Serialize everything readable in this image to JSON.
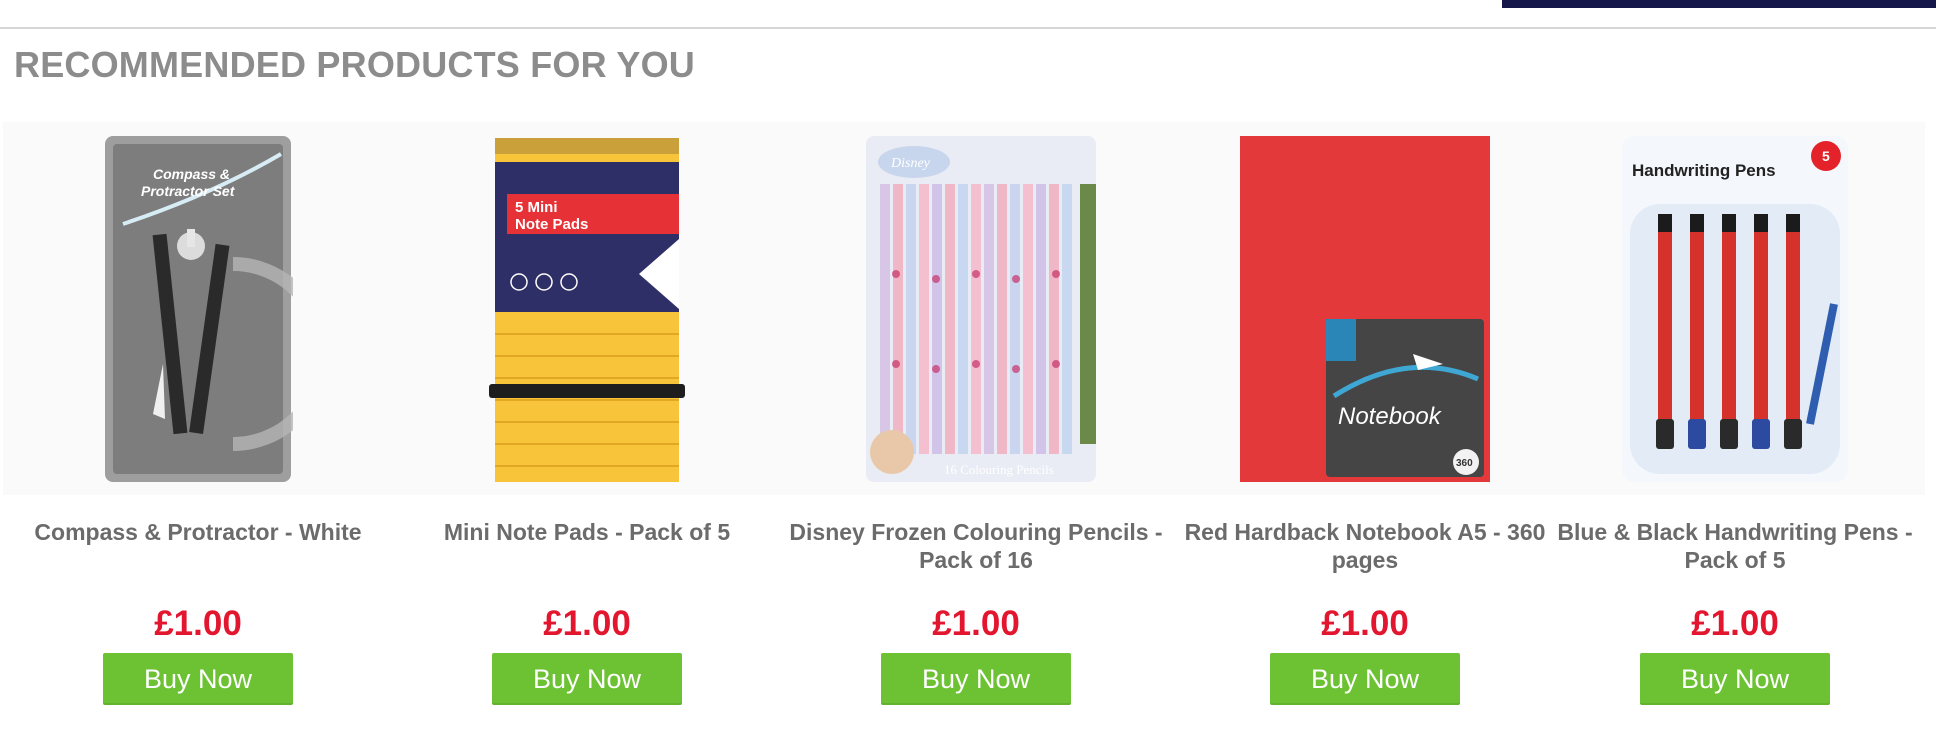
{
  "section": {
    "title": "RECOMMENDED PRODUCTS FOR YOU"
  },
  "products": [
    {
      "name": "Compass & Protractor - White",
      "price": "£1.00",
      "buy_label": "Buy Now",
      "package_text": [
        "Compass &",
        "Protractor Set"
      ]
    },
    {
      "name": "Mini Note Pads - Pack of 5",
      "price": "£1.00",
      "buy_label": "Buy Now",
      "package_text": [
        "5 Mini",
        "Note Pads"
      ]
    },
    {
      "name": "Disney Frozen Colouring Pencils - Pack of 16",
      "price": "£1.00",
      "buy_label": "Buy Now",
      "package_text": [
        "Disney",
        "16 Colouring Pencils"
      ]
    },
    {
      "name": "Red Hardback Notebook A5 - 360 pages",
      "price": "£1.00",
      "buy_label": "Buy Now",
      "package_text": [
        "Notebook",
        "360"
      ]
    },
    {
      "name": "Blue & Black Handwriting Pens - Pack of 5",
      "price": "£1.00",
      "buy_label": "Buy Now",
      "package_text": [
        "Handwriting Pens",
        "5"
      ]
    }
  ],
  "colors": {
    "price": "#e3162f",
    "button": "#6cc233",
    "title": "#8c8c8c",
    "accent_bar": "#15174a"
  }
}
